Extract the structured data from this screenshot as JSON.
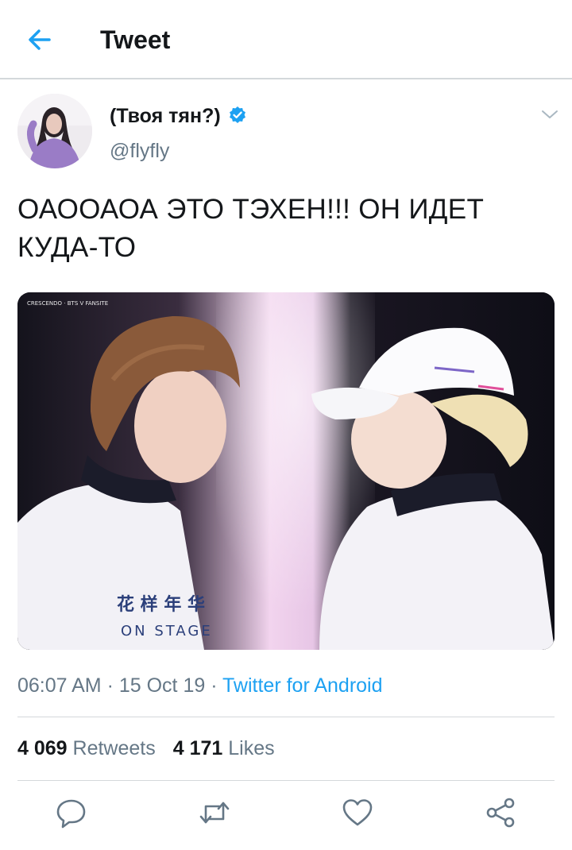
{
  "header": {
    "title": "Tweet",
    "back_icon": "back-arrow-icon"
  },
  "tweet": {
    "user": {
      "name": "(Твоя тян?)",
      "handle": "@flyfly",
      "verified": true
    },
    "text": "ОАООАОА ЭТО ТЭХЕН!!! ОН ИДЕТ КУДА-ТО",
    "media": {
      "watermark": "CRESCENDO · BTS V FANSITE"
    },
    "time": "06:07 AM",
    "date": "15 Oct 19",
    "source": "Twitter for Android",
    "separator": " · ",
    "retweets": {
      "count": "4 069",
      "label": "Retweets"
    },
    "likes": {
      "count": "4 171",
      "label": "Likes"
    }
  },
  "actions": [
    {
      "name": "reply",
      "icon": "reply-icon"
    },
    {
      "name": "retweet",
      "icon": "retweet-icon"
    },
    {
      "name": "like",
      "icon": "heart-icon"
    },
    {
      "name": "share",
      "icon": "share-icon"
    }
  ],
  "colors": {
    "accent": "#1da1f2",
    "text": "#14171a",
    "secondary": "#657786",
    "divider": "#d4d8db"
  }
}
